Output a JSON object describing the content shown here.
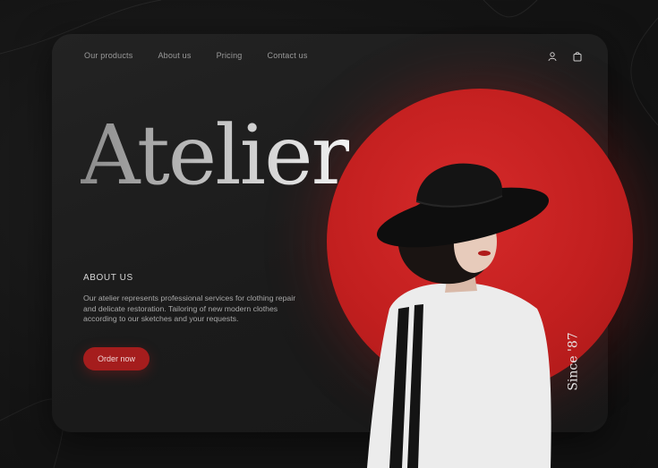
{
  "nav": {
    "items": [
      "Our products",
      "About us",
      "Pricing",
      "Contact us"
    ],
    "account_icon": "user-icon",
    "cart_icon": "shopping-bag-icon"
  },
  "hero": {
    "title": "Atelier",
    "since": "Since '87"
  },
  "about": {
    "heading": "ABOUT US",
    "text": "Our atelier represents professional services for clothing repair and delicate restoration. Tailoring of new modern clothes according to our sketches and your requests.",
    "cta_label": "Order now"
  },
  "colors": {
    "accent": "#c21f1f",
    "button": "#a51d1d",
    "background": "#141414",
    "card": "#1f1f1f"
  }
}
